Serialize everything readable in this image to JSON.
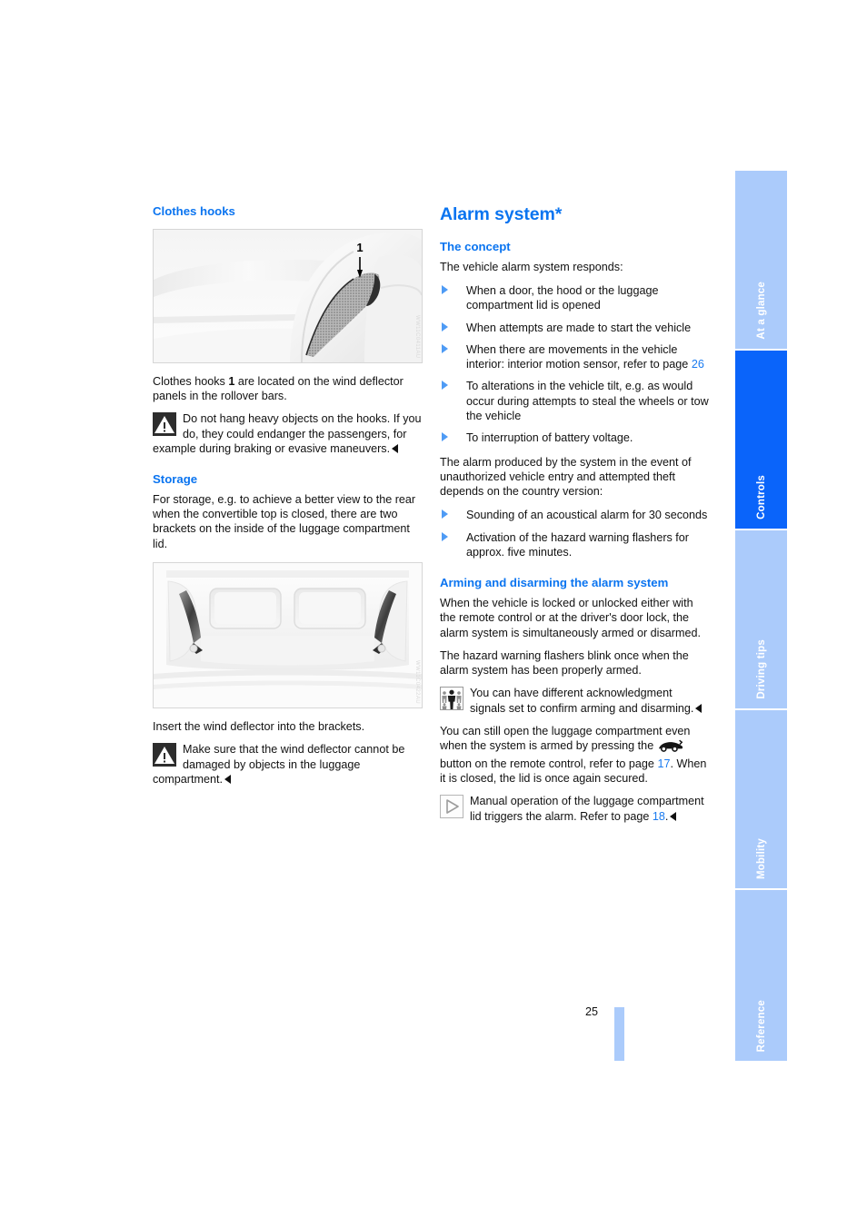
{
  "document": {
    "page_number": "25",
    "accent_color": "#0a74f0",
    "tab_active_color": "#0a64fa",
    "tab_inactive_color": "#abcbfb"
  },
  "tabs": [
    {
      "label": "At a glance",
      "active": false
    },
    {
      "label": "Controls",
      "active": true
    },
    {
      "label": "Driving tips",
      "active": false
    },
    {
      "label": "Mobility",
      "active": false
    },
    {
      "label": "Reference",
      "active": false
    }
  ],
  "left_column": {
    "clothes_hooks": {
      "heading": "Clothes hooks",
      "figure": {
        "name": "clothes-hook-on-rollover-bar",
        "callout": "1",
        "watermark": "WW11C0411AU"
      },
      "paragraph": {
        "before": "Clothes hooks ",
        "bold": "1",
        "after": " are located on the wind deflector panels in the rollover bars."
      },
      "warning": {
        "icon": "warning-triangle-icon",
        "text": "Do not hang heavy objects on the hooks. If you do, they could endanger the passengers, for example during braking or evasive maneuvers."
      }
    },
    "storage": {
      "heading": "Storage",
      "intro": "For storage, e.g. to achieve a better view to the rear when the convertible top is closed, there are two brackets on the inside of the luggage compartment lid.",
      "figure": {
        "name": "wind-deflector-brackets-in-luggage-compartment-lid",
        "watermark": "WW11C0422AU"
      },
      "instruction": "Insert the wind deflector into the brackets.",
      "warning": {
        "icon": "warning-triangle-icon",
        "text": "Make sure that the wind deflector cannot be damaged by objects in the luggage compartment."
      }
    }
  },
  "right_column": {
    "chapter_title": "Alarm system*",
    "concept": {
      "heading": "The concept",
      "intro": "The vehicle alarm system responds:",
      "bullets": [
        {
          "text": "When a door, the hood or the luggage compartment lid is opened"
        },
        {
          "text": "When attempts are made to start the vehicle"
        },
        {
          "text": "When there are movements in the vehicle interior: interior motion sensor, refer to page ",
          "ref": "26"
        },
        {
          "text": "To alterations in the vehicle tilt, e.g. as would occur during attempts to steal the wheels or tow the vehicle"
        },
        {
          "text": "To interruption of battery voltage."
        }
      ],
      "paragraph": "The alarm produced by the system in the event of unauthorized vehicle entry and attempted theft depends on the country version:",
      "bullets2": [
        {
          "text": "Sounding of an acoustical alarm for 30 seconds"
        },
        {
          "text": "Activation of the hazard warning flashers for approx. five minutes."
        }
      ]
    },
    "arming": {
      "heading": "Arming and disarming the alarm system",
      "paragraph1": "When the vehicle is locked or unlocked either with the remote control or at the driver's door lock, the alarm system is simultaneously armed or disarmed.",
      "paragraph2": "The hazard warning flashers blink once when the alarm system has been properly armed.",
      "note_people": {
        "icon": "people-figures-icon",
        "text": "You can have different acknowledgment signals set to confirm arming and disarming."
      },
      "paragraph3_part1": "You can still open the luggage compartment even when the system is armed by pressing the ",
      "paragraph3_icon": "car-open-trunk-icon",
      "paragraph3_part2": " button on the remote control, refer to page ",
      "paragraph3_ref": "17",
      "paragraph3_part3": ". When it is closed, the lid is once again secured.",
      "note_manual": {
        "icon": "play-triangle-outline-icon",
        "text_part1": "Manual operation of the luggage compartment lid triggers the alarm. Refer to page ",
        "ref": "18",
        "text_part2": "."
      }
    }
  }
}
